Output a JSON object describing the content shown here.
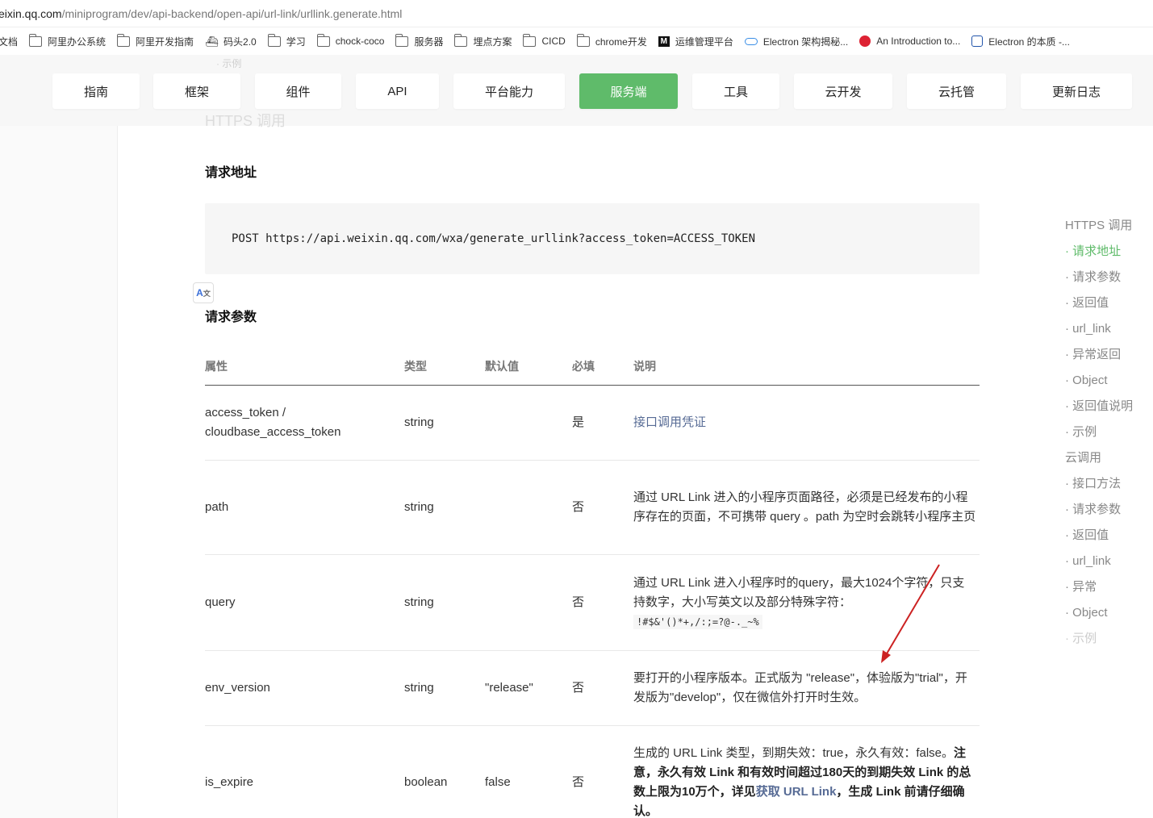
{
  "browser": {
    "url_host": "eixin.qq.com",
    "url_path": "/miniprogram/dev/api-backend/open-api/url-link/urllink.generate.html",
    "bookmarks": [
      {
        "label": "文档",
        "icon": "none"
      },
      {
        "label": "阿里办公系统",
        "icon": "folder-icon"
      },
      {
        "label": "阿里开发指南",
        "icon": "folder-icon"
      },
      {
        "label": "码头2.0",
        "icon": "ship-icon"
      },
      {
        "label": "学习",
        "icon": "folder-icon"
      },
      {
        "label": "chock-coco",
        "icon": "folder-icon"
      },
      {
        "label": "服务器",
        "icon": "folder-icon"
      },
      {
        "label": "埋点方案",
        "icon": "folder-icon"
      },
      {
        "label": "CICD",
        "icon": "folder-icon"
      },
      {
        "label": "chrome开发",
        "icon": "folder-icon"
      },
      {
        "label": "运维管理平台",
        "icon": "m-logo-icon"
      },
      {
        "label": "Electron 架构揭秘...",
        "icon": "cloud-icon"
      },
      {
        "label": "An Introduction to...",
        "icon": "red-circle-icon"
      },
      {
        "label": "Electron 的本质 -...",
        "icon": "blue-badge-icon"
      }
    ]
  },
  "topnav": {
    "ghost_top": "· 示例",
    "ghost_heading": "HTTPS 调用",
    "items": [
      {
        "label": "指南"
      },
      {
        "label": "框架"
      },
      {
        "label": "组件"
      },
      {
        "label": "API"
      },
      {
        "label": "平台能力"
      },
      {
        "label": "服务端",
        "active": true
      },
      {
        "label": "工具"
      },
      {
        "label": "云开发"
      },
      {
        "label": "云托管"
      },
      {
        "label": "更新日志"
      }
    ],
    "accent_color": "#5fbb6a"
  },
  "main": {
    "request_url_title": "请求地址",
    "request_url_code": "POST https://api.weixin.qq.com/wxa/generate_urllink?access_token=ACCESS_TOKEN",
    "params_title": "请求参数",
    "table": {
      "headers": [
        "属性",
        "类型",
        "默认值",
        "必填",
        "说明"
      ],
      "rows": [
        {
          "name_line1": "access_token /",
          "name_line2": "cloudbase_access_token",
          "type": "string",
          "default": "",
          "required": "是",
          "desc_link": "接口调用凭证"
        },
        {
          "name": "path",
          "type": "string",
          "default": "",
          "required": "否",
          "desc": "通过 URL Link 进入的小程序页面路径，必须是已经发布的小程序存在的页面，不可携带 query 。path 为空时会跳转小程序主页"
        },
        {
          "name": "query",
          "type": "string",
          "default": "",
          "required": "否",
          "desc": "通过 URL Link 进入小程序时的query，最大1024个字符，只支持数字，大小写英文以及部分特殊字符：",
          "desc_code": "!#$&'()*+,/:;=?@-._~%"
        },
        {
          "name": "env_version",
          "type": "string",
          "default": "\"release\"",
          "required": "否",
          "desc": "要打开的小程序版本。正式版为 \"release\"，体验版为\"trial\"，开发版为\"develop\"，仅在微信外打开时生效。"
        },
        {
          "name": "is_expire",
          "type": "boolean",
          "default": "false",
          "required": "否",
          "desc_plain": "生成的 URL Link 类型，到期失效：true，永久有效：false。",
          "desc_bold1": "注意，永久有效 Link 和有效时间超过180天的到期失效 Link 的总数上限为10万个，详见",
          "desc_bold_link": "获取 URL Link",
          "desc_bold2": "，生成 Link 前请仔细确认。"
        }
      ]
    }
  },
  "toc": {
    "items": [
      {
        "label": "HTTPS 调用",
        "level": 1
      },
      {
        "label": "请求地址",
        "level": 2,
        "active": true
      },
      {
        "label": "请求参数",
        "level": 2
      },
      {
        "label": "返回值",
        "level": 2
      },
      {
        "label": "url_link",
        "level": 2
      },
      {
        "label": "异常返回",
        "level": 2
      },
      {
        "label": "Object",
        "level": 2
      },
      {
        "label": "返回值说明",
        "level": 2
      },
      {
        "label": "示例",
        "level": 2
      },
      {
        "label": "云调用",
        "level": 1
      },
      {
        "label": "接口方法",
        "level": 2
      },
      {
        "label": "请求参数",
        "level": 2
      },
      {
        "label": "返回值",
        "level": 2
      },
      {
        "label": "url_link",
        "level": 2
      },
      {
        "label": "异常",
        "level": 2
      },
      {
        "label": "Object",
        "level": 2
      },
      {
        "label": "示例",
        "level": 2,
        "faded": true
      }
    ]
  }
}
